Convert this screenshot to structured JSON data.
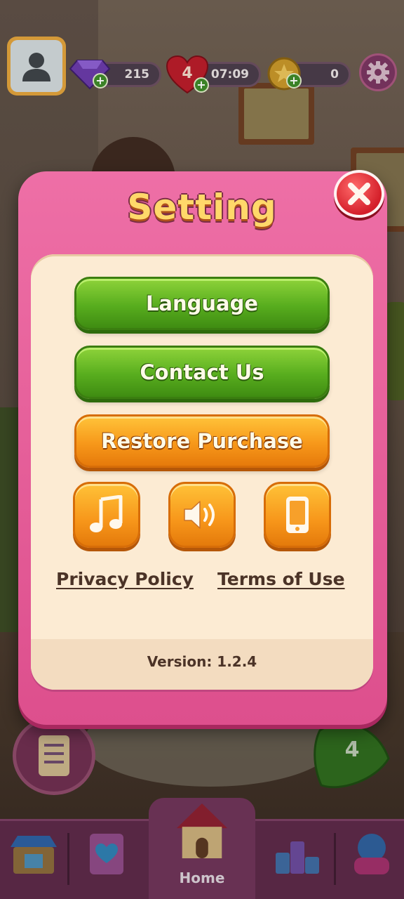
{
  "hud": {
    "gems": "215",
    "lives_count": "4",
    "lives_timer": "07:09",
    "coins": "0",
    "icons": {
      "avatar": "user-icon",
      "gems": "gem-icon",
      "lives": "heart-icon",
      "coins": "coin-icon",
      "settings": "gear-icon"
    }
  },
  "dialog": {
    "title": "Setting",
    "buttons": {
      "language": "Language",
      "contact": "Contact Us",
      "restore": "Restore Purchase"
    },
    "toggles": [
      {
        "name": "music",
        "icon": "music-note-icon"
      },
      {
        "name": "sound",
        "icon": "speaker-icon"
      },
      {
        "name": "vibration",
        "icon": "phone-icon"
      }
    ],
    "links": {
      "privacy": "Privacy Policy",
      "terms": "Terms of Use"
    },
    "version": "Version: 1.2.4"
  },
  "background": {
    "level_number": "4",
    "nav": {
      "home_label": "Home",
      "items": [
        "shop-icon",
        "album-icon",
        "home-icon",
        "leaderboard-icon",
        "event-icon"
      ]
    }
  },
  "colors": {
    "dialog_pink": "#e65a97",
    "panel_cream": "#fcebd3",
    "green_button": "#5cb020",
    "orange_button": "#f7981a",
    "title_yellow": "#ffd86a",
    "close_red": "#d41f2a"
  }
}
